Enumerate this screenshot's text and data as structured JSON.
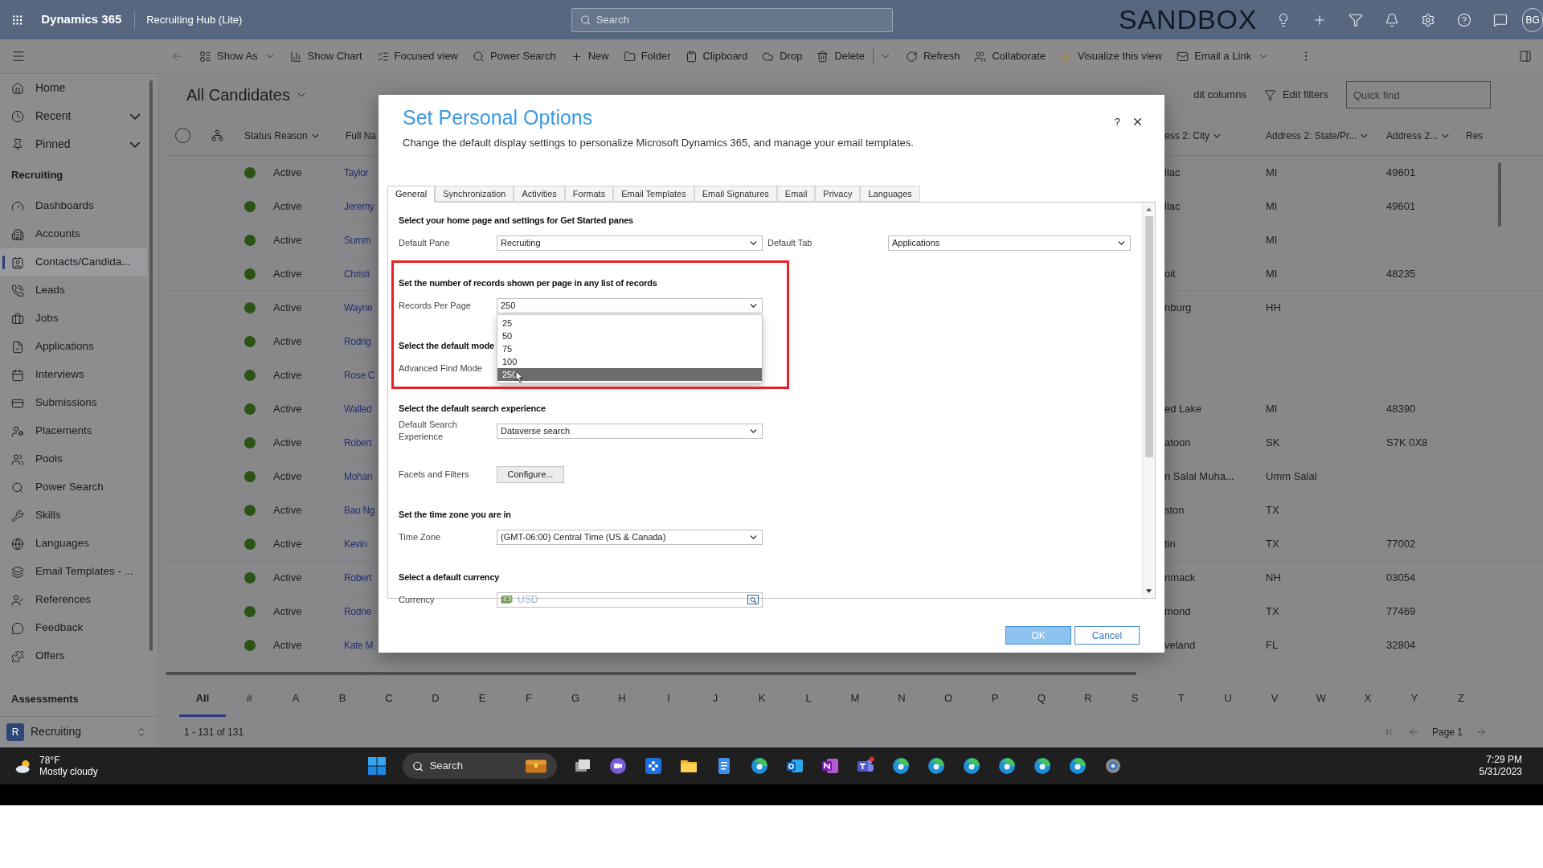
{
  "top_bar": {
    "app_name": "Dynamics 365",
    "area_name": "Recruiting Hub (Lite)",
    "search": {
      "placeholder": "Search"
    },
    "environment": "SANDBOX",
    "avatar": "BG"
  },
  "command_bar": [
    {
      "label": "Show As",
      "kind": "split"
    },
    {
      "label": "Show Chart",
      "kind": "button"
    },
    {
      "label": "Focused view",
      "kind": "button"
    },
    {
      "label": "Power Search",
      "kind": "button"
    },
    {
      "label": "New",
      "kind": "button"
    },
    {
      "label": "Folder",
      "kind": "button"
    },
    {
      "label": "Clipboard",
      "kind": "button"
    },
    {
      "label": "Drop",
      "kind": "button"
    },
    {
      "label": "Delete",
      "kind": "divided"
    },
    {
      "label": "Refresh",
      "kind": "button"
    },
    {
      "label": "Collaborate",
      "kind": "button"
    },
    {
      "label": "Visualize this view",
      "kind": "button"
    },
    {
      "label": "Email a Link",
      "kind": "split"
    }
  ],
  "sidebar": {
    "links": [
      {
        "label": "Home",
        "kind": "link"
      },
      {
        "label": "Recent",
        "kind": "flyout",
        "expanded": false
      },
      {
        "label": "Pinned",
        "kind": "flyout",
        "expanded": false
      }
    ],
    "groups": [
      {
        "title": "Recruiting",
        "items": [
          {
            "label": "Dashboards",
            "selected": false
          },
          {
            "label": "Accounts",
            "selected": false
          },
          {
            "label": "Contacts/Candida...",
            "selected": true
          },
          {
            "label": "Leads",
            "selected": false
          },
          {
            "label": "Jobs",
            "selected": false
          },
          {
            "label": "Applications",
            "selected": false
          },
          {
            "label": "Interviews",
            "selected": false
          },
          {
            "label": "Submissions",
            "selected": false
          },
          {
            "label": "Placements",
            "selected": false
          },
          {
            "label": "Pools",
            "selected": false
          },
          {
            "label": "Power Search",
            "selected": false
          },
          {
            "label": "Skills",
            "selected": false
          },
          {
            "label": "Languages",
            "selected": false
          },
          {
            "label": "Email Templates - ...",
            "selected": false
          },
          {
            "label": "References",
            "selected": false
          },
          {
            "label": "Feedback",
            "selected": false
          },
          {
            "label": "Offers",
            "selected": false
          }
        ]
      },
      {
        "title": "Assessments"
      }
    ],
    "area_switcher": {
      "initial": "R",
      "label": "Recruiting"
    }
  },
  "view": {
    "title": "All Candidates",
    "commands": [
      {
        "label": "dit columns",
        "kind": "text"
      },
      {
        "label": "Edit filters",
        "kind": "filter"
      }
    ],
    "quick_find": {
      "placeholder": "Quick find"
    }
  },
  "table": {
    "select_all": {
      "checked": false
    },
    "columns": [
      {
        "label": "Status Reason",
        "has_menu": true
      },
      {
        "label": "Full Na",
        "has_menu": false
      },
      {
        "label": "ess 2: City",
        "has_menu": true
      },
      {
        "label": "Address 2: State/Pr...",
        "has_menu": true
      },
      {
        "label": "Address 2...",
        "has_menu": true
      },
      {
        "label": "Res",
        "has_menu": false
      }
    ],
    "rows": [
      {
        "status": "Active",
        "name": "Taylor",
        "city": "llac",
        "state": "MI",
        "zip": "49601"
      },
      {
        "status": "Active",
        "name": "Jeremy",
        "city": "llac",
        "state": "MI",
        "zip": "49601"
      },
      {
        "status": "Active",
        "name": "Summ",
        "state": "MI"
      },
      {
        "status": "Active",
        "name": "Christi",
        "city": "oit",
        "state": "MI",
        "zip": "48235"
      },
      {
        "status": "Active",
        "name": "Wayne",
        "city": "nburg",
        "state": "HH"
      },
      {
        "status": "Active",
        "name": "Rodrig"
      },
      {
        "status": "Active",
        "name": "Rose C"
      },
      {
        "status": "Active",
        "name": "Walled",
        "city": "ed Lake",
        "state": "MI",
        "zip": "48390"
      },
      {
        "status": "Active",
        "name": "Robert",
        "city": "atoon",
        "state": "SK",
        "zip": "S7K 0X8"
      },
      {
        "status": "Active",
        "name": "Mohan",
        "city": "n Salal Muha...",
        "state": "Umm Salal"
      },
      {
        "status": "Active",
        "name": "Bao Ng",
        "city": "ston",
        "state": "TX"
      },
      {
        "status": "Active",
        "name": "Kevin",
        "city": "tin",
        "state": "TX",
        "zip": "77002"
      },
      {
        "status": "Active",
        "name": "Robert",
        "city": "rimack",
        "state": "NH",
        "zip": "03054"
      },
      {
        "status": "Active",
        "name": "Rodne",
        "city": "mond",
        "state": "TX",
        "zip": "77469"
      },
      {
        "status": "Active",
        "name": "Kate M",
        "city": "veland",
        "state": "FL",
        "zip": "32804"
      }
    ]
  },
  "jump_bar": {
    "items": [
      {
        "label": "All",
        "selected": true
      },
      {
        "label": "#",
        "selected": false
      },
      {
        "label": "A",
        "selected": false
      },
      {
        "label": "B",
        "selected": false
      },
      {
        "label": "C",
        "selected": false
      },
      {
        "label": "D",
        "selected": false
      },
      {
        "label": "E",
        "selected": false
      },
      {
        "label": "F",
        "selected": false
      },
      {
        "label": "G",
        "selected": false
      },
      {
        "label": "H",
        "selected": false
      },
      {
        "label": "I",
        "selected": false
      },
      {
        "label": "J",
        "selected": false
      },
      {
        "label": "K",
        "selected": false
      },
      {
        "label": "L",
        "selected": false
      },
      {
        "label": "M",
        "selected": false
      },
      {
        "label": "N",
        "selected": false
      },
      {
        "label": "O",
        "selected": false
      },
      {
        "label": "P",
        "selected": false
      },
      {
        "label": "Q",
        "selected": false
      },
      {
        "label": "R",
        "selected": false
      },
      {
        "label": "S",
        "selected": false
      },
      {
        "label": "T",
        "selected": false
      },
      {
        "label": "U",
        "selected": false
      },
      {
        "label": "V",
        "selected": false
      },
      {
        "label": "W",
        "selected": false
      },
      {
        "label": "X",
        "selected": false
      },
      {
        "label": "Y",
        "selected": false
      },
      {
        "label": "Z",
        "selected": false
      }
    ],
    "record_count": "1 - 131 of 131",
    "page": "Page 1"
  },
  "dialog": {
    "title": "Set Personal Options",
    "description": "Change the default display settings to personalize Microsoft Dynamics 365, and manage your email templates.",
    "help_label": "?",
    "tabs": [
      {
        "label": "General",
        "selected": true
      },
      {
        "label": "Synchronization",
        "selected": false
      },
      {
        "label": "Activities",
        "selected": false
      },
      {
        "label": "Formats",
        "selected": false
      },
      {
        "label": "Email Templates",
        "selected": false
      },
      {
        "label": "Email Signatures",
        "selected": false
      },
      {
        "label": "Email",
        "selected": false
      },
      {
        "label": "Privacy",
        "selected": false
      },
      {
        "label": "Languages",
        "selected": false
      }
    ],
    "sections": [
      {
        "heading": "Select your home page and settings for Get Started panes",
        "highlighted": false,
        "rows": [
          {
            "fields": [
              {
                "label": "Default Pane",
                "kind": "select",
                "value": "Recruiting"
              },
              {
                "label": "Default Tab",
                "kind": "select",
                "value": "Applications"
              }
            ]
          }
        ]
      },
      {
        "heading": "Set the number of records shown per page in any list of records",
        "highlighted": true,
        "rows": [
          {
            "fields": [
              {
                "label": "Records Per Page",
                "kind": "select",
                "value": "250",
                "expanded": true,
                "options": [
                  {
                    "label": "25",
                    "selected": false
                  },
                  {
                    "label": "50",
                    "selected": false
                  },
                  {
                    "label": "75",
                    "selected": false
                  },
                  {
                    "label": "100",
                    "selected": false
                  },
                  {
                    "label": "250",
                    "selected": true
                  }
                ]
              }
            ]
          }
        ]
      },
      {
        "heading": "Select the default mode",
        "highlighted": false,
        "rows": [
          {
            "fields": [
              {
                "label": "Advanced Find Mode",
                "kind": "covered"
              }
            ]
          }
        ]
      },
      {
        "heading": "Select the default search experience",
        "highlighted": false,
        "rows": [
          {
            "fields": [
              {
                "label": "Default Search Experience",
                "kind": "select",
                "value": "Dataverse search"
              }
            ]
          },
          {
            "fields": [
              {
                "label": "Facets and Filters",
                "kind": "button",
                "value": "Configure..."
              }
            ]
          }
        ]
      },
      {
        "heading": "Set the time zone you are in",
        "highlighted": false,
        "rows": [
          {
            "fields": [
              {
                "label": "Time Zone",
                "kind": "select",
                "value": "(GMT-06:00) Central Time (US & Canada)"
              }
            ]
          }
        ]
      },
      {
        "heading": "Select a default currency",
        "highlighted": false,
        "rows": [
          {
            "fields": [
              {
                "label": "Currency",
                "kind": "lookup",
                "value": "USD"
              }
            ]
          }
        ]
      }
    ],
    "buttons": [
      {
        "label": "OK",
        "kind": "primary"
      },
      {
        "label": "Cancel",
        "kind": "secondary"
      }
    ]
  },
  "taskbar": {
    "weather": {
      "temperature": "78°F",
      "condition": "Mostly cloudy"
    },
    "search": {
      "placeholder": "Search"
    },
    "clock": {
      "time": "7:29 PM",
      "date": "5/31/2023"
    }
  }
}
